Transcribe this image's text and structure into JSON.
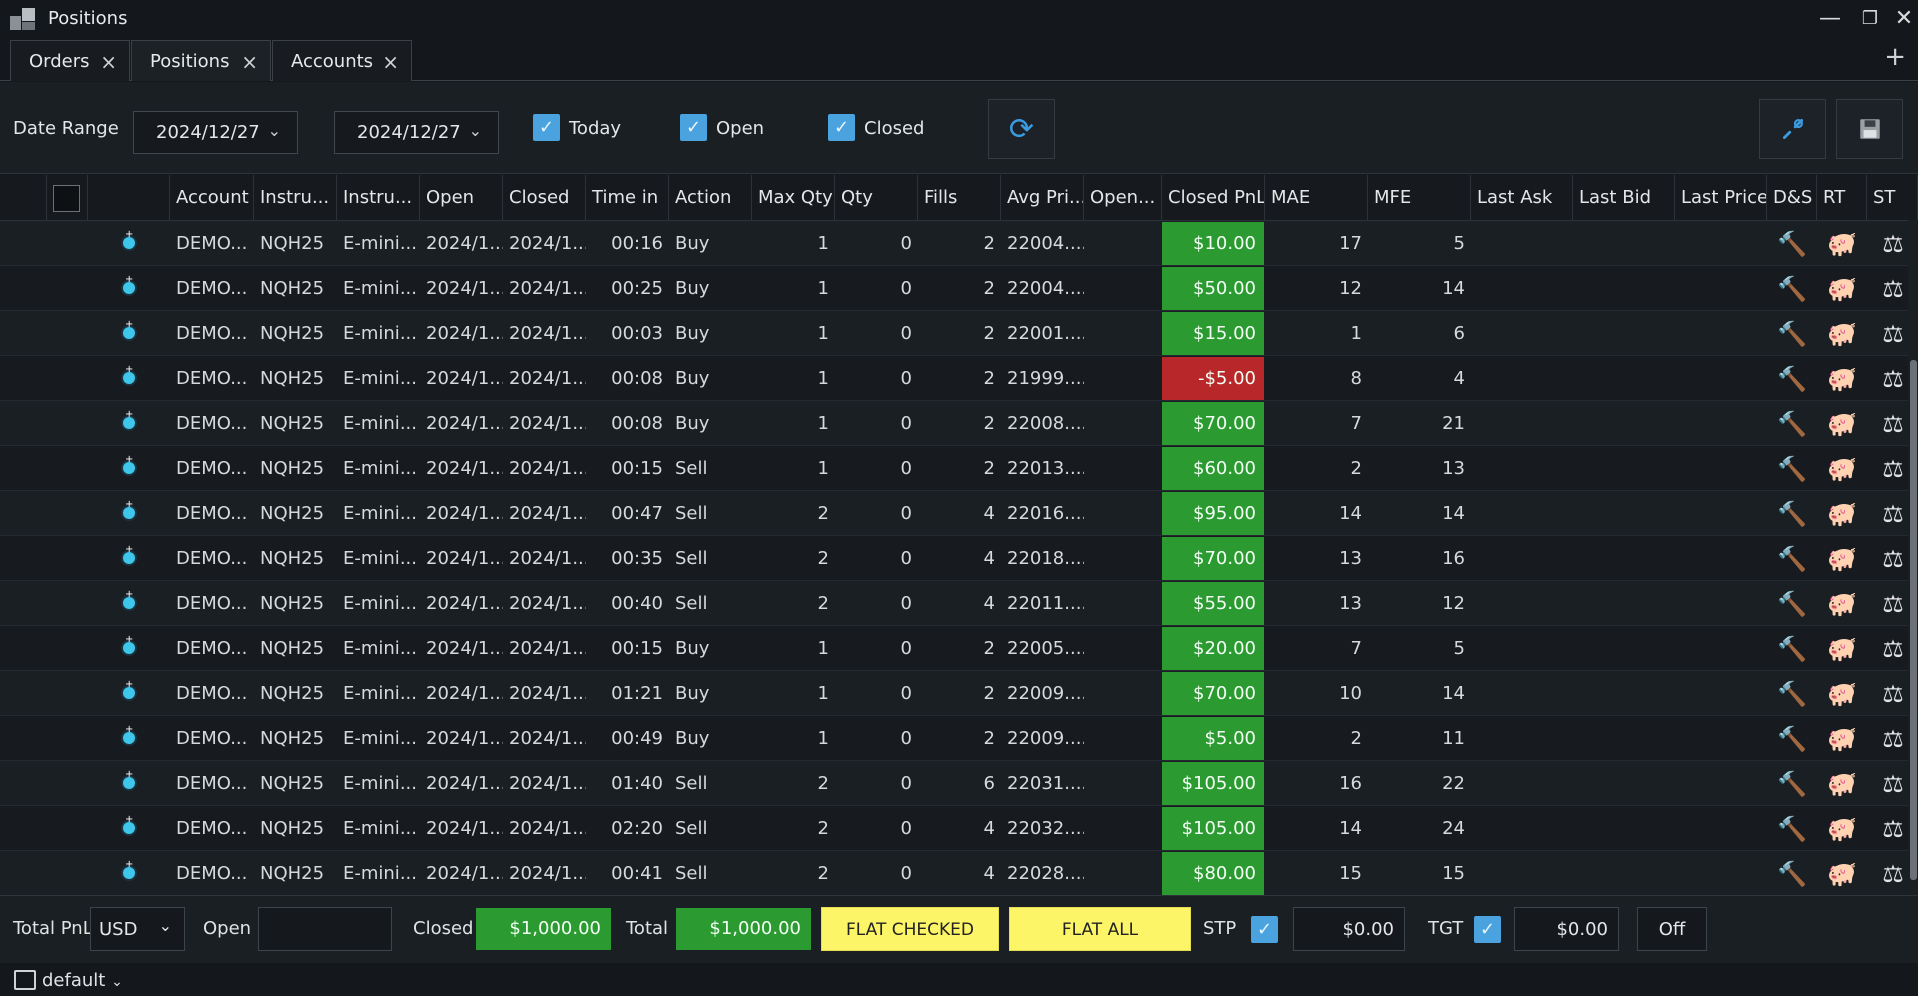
{
  "window": {
    "title": "Positions"
  },
  "tabs": [
    {
      "label": "Orders"
    },
    {
      "label": "Positions"
    },
    {
      "label": "Accounts"
    }
  ],
  "toolbar": {
    "date_range_label": "Date Range",
    "date_from": "2024/12/27",
    "date_to": "2024/12/27",
    "filters": [
      {
        "label": "Today",
        "checked": true
      },
      {
        "label": "Open",
        "checked": true
      },
      {
        "label": "Closed",
        "checked": true
      }
    ]
  },
  "columns": [
    "Account",
    "Instru...",
    "Instru...",
    "Open",
    "Closed",
    "Time in",
    "Action",
    "Max Qty",
    "Qty",
    "Fills",
    "Avg Pri...",
    "Open...",
    "Closed PnL",
    "MAE",
    "MFE",
    "Last Ask",
    "Last Bid",
    "Last Price",
    "D&S",
    "RT",
    "ST"
  ],
  "rows": [
    {
      "account": "DEMO...",
      "instr": "NQH25",
      "instr_name": "E-mini...",
      "open": "2024/1...",
      "closed": "2024/1...",
      "time_in": "00:16",
      "action": "Buy",
      "max_qty": "1",
      "qty": "0",
      "fills": "2",
      "avg_price": "22004....",
      "closed_pnl": "$10.00",
      "pnl_sign": "pos",
      "mae": "17",
      "mfe": "5"
    },
    {
      "account": "DEMO...",
      "instr": "NQH25",
      "instr_name": "E-mini...",
      "open": "2024/1...",
      "closed": "2024/1...",
      "time_in": "00:25",
      "action": "Buy",
      "max_qty": "1",
      "qty": "0",
      "fills": "2",
      "avg_price": "22004....",
      "closed_pnl": "$50.00",
      "pnl_sign": "pos",
      "mae": "12",
      "mfe": "14"
    },
    {
      "account": "DEMO...",
      "instr": "NQH25",
      "instr_name": "E-mini...",
      "open": "2024/1...",
      "closed": "2024/1...",
      "time_in": "00:03",
      "action": "Buy",
      "max_qty": "1",
      "qty": "0",
      "fills": "2",
      "avg_price": "22001....",
      "closed_pnl": "$15.00",
      "pnl_sign": "pos",
      "mae": "1",
      "mfe": "6"
    },
    {
      "account": "DEMO...",
      "instr": "NQH25",
      "instr_name": "E-mini...",
      "open": "2024/1...",
      "closed": "2024/1...",
      "time_in": "00:08",
      "action": "Buy",
      "max_qty": "1",
      "qty": "0",
      "fills": "2",
      "avg_price": "21999....",
      "closed_pnl": "-$5.00",
      "pnl_sign": "neg",
      "mae": "8",
      "mfe": "4"
    },
    {
      "account": "DEMO...",
      "instr": "NQH25",
      "instr_name": "E-mini...",
      "open": "2024/1...",
      "closed": "2024/1...",
      "time_in": "00:08",
      "action": "Buy",
      "max_qty": "1",
      "qty": "0",
      "fills": "2",
      "avg_price": "22008....",
      "closed_pnl": "$70.00",
      "pnl_sign": "pos",
      "mae": "7",
      "mfe": "21"
    },
    {
      "account": "DEMO...",
      "instr": "NQH25",
      "instr_name": "E-mini...",
      "open": "2024/1...",
      "closed": "2024/1...",
      "time_in": "00:15",
      "action": "Sell",
      "max_qty": "1",
      "qty": "0",
      "fills": "2",
      "avg_price": "22013....",
      "closed_pnl": "$60.00",
      "pnl_sign": "pos",
      "mae": "2",
      "mfe": "13"
    },
    {
      "account": "DEMO...",
      "instr": "NQH25",
      "instr_name": "E-mini...",
      "open": "2024/1...",
      "closed": "2024/1...",
      "time_in": "00:47",
      "action": "Sell",
      "max_qty": "2",
      "qty": "0",
      "fills": "4",
      "avg_price": "22016....",
      "closed_pnl": "$95.00",
      "pnl_sign": "pos",
      "mae": "14",
      "mfe": "14"
    },
    {
      "account": "DEMO...",
      "instr": "NQH25",
      "instr_name": "E-mini...",
      "open": "2024/1...",
      "closed": "2024/1...",
      "time_in": "00:35",
      "action": "Sell",
      "max_qty": "2",
      "qty": "0",
      "fills": "4",
      "avg_price": "22018....",
      "closed_pnl": "$70.00",
      "pnl_sign": "pos",
      "mae": "13",
      "mfe": "16"
    },
    {
      "account": "DEMO...",
      "instr": "NQH25",
      "instr_name": "E-mini...",
      "open": "2024/1...",
      "closed": "2024/1...",
      "time_in": "00:40",
      "action": "Sell",
      "max_qty": "2",
      "qty": "0",
      "fills": "4",
      "avg_price": "22011....",
      "closed_pnl": "$55.00",
      "pnl_sign": "pos",
      "mae": "13",
      "mfe": "12"
    },
    {
      "account": "DEMO...",
      "instr": "NQH25",
      "instr_name": "E-mini...",
      "open": "2024/1...",
      "closed": "2024/1...",
      "time_in": "00:15",
      "action": "Buy",
      "max_qty": "1",
      "qty": "0",
      "fills": "2",
      "avg_price": "22005....",
      "closed_pnl": "$20.00",
      "pnl_sign": "pos",
      "mae": "7",
      "mfe": "5"
    },
    {
      "account": "DEMO...",
      "instr": "NQH25",
      "instr_name": "E-mini...",
      "open": "2024/1...",
      "closed": "2024/1...",
      "time_in": "01:21",
      "action": "Buy",
      "max_qty": "1",
      "qty": "0",
      "fills": "2",
      "avg_price": "22009....",
      "closed_pnl": "$70.00",
      "pnl_sign": "pos",
      "mae": "10",
      "mfe": "14"
    },
    {
      "account": "DEMO...",
      "instr": "NQH25",
      "instr_name": "E-mini...",
      "open": "2024/1...",
      "closed": "2024/1...",
      "time_in": "00:49",
      "action": "Buy",
      "max_qty": "1",
      "qty": "0",
      "fills": "2",
      "avg_price": "22009....",
      "closed_pnl": "$5.00",
      "pnl_sign": "pos",
      "mae": "2",
      "mfe": "11"
    },
    {
      "account": "DEMO...",
      "instr": "NQH25",
      "instr_name": "E-mini...",
      "open": "2024/1...",
      "closed": "2024/1...",
      "time_in": "01:40",
      "action": "Sell",
      "max_qty": "2",
      "qty": "0",
      "fills": "6",
      "avg_price": "22031....",
      "closed_pnl": "$105.00",
      "pnl_sign": "pos",
      "mae": "16",
      "mfe": "22"
    },
    {
      "account": "DEMO...",
      "instr": "NQH25",
      "instr_name": "E-mini...",
      "open": "2024/1...",
      "closed": "2024/1...",
      "time_in": "02:20",
      "action": "Sell",
      "max_qty": "2",
      "qty": "0",
      "fills": "4",
      "avg_price": "22032....",
      "closed_pnl": "$105.00",
      "pnl_sign": "pos",
      "mae": "14",
      "mfe": "24"
    },
    {
      "account": "DEMO...",
      "instr": "NQH25",
      "instr_name": "E-mini...",
      "open": "2024/1...",
      "closed": "2024/1...",
      "time_in": "00:41",
      "action": "Sell",
      "max_qty": "2",
      "qty": "0",
      "fills": "4",
      "avg_price": "22028....",
      "closed_pnl": "$80.00",
      "pnl_sign": "pos",
      "mae": "15",
      "mfe": "15"
    }
  ],
  "footer": {
    "total_pnl_label": "Total PnL",
    "currency": "USD",
    "open_label": "Open",
    "open_value": "",
    "closed_label": "Closed",
    "closed_value": "$1,000.00",
    "total_label": "Total",
    "total_value": "$1,000.00",
    "flat_checked_label": "FLAT CHECKED",
    "flat_all_label": "FLAT ALL",
    "stp_label": "STP",
    "stp_checked": true,
    "stp_value": "$0.00",
    "tgt_label": "TGT",
    "tgt_checked": true,
    "tgt_value": "$0.00",
    "off_label": "Off"
  },
  "statusbar": {
    "workspace": "default"
  },
  "colors": {
    "accent": "#4aa3df",
    "positive": "#2a9a31",
    "negative": "#b8282b",
    "flat_button": "#fdf568"
  },
  "icons": {
    "refresh": "refresh-icon",
    "settings": "wrench-icon",
    "save": "save-icon",
    "ds": "gavel-icon",
    "rt": "piggy-icon",
    "st": "scale-icon"
  }
}
